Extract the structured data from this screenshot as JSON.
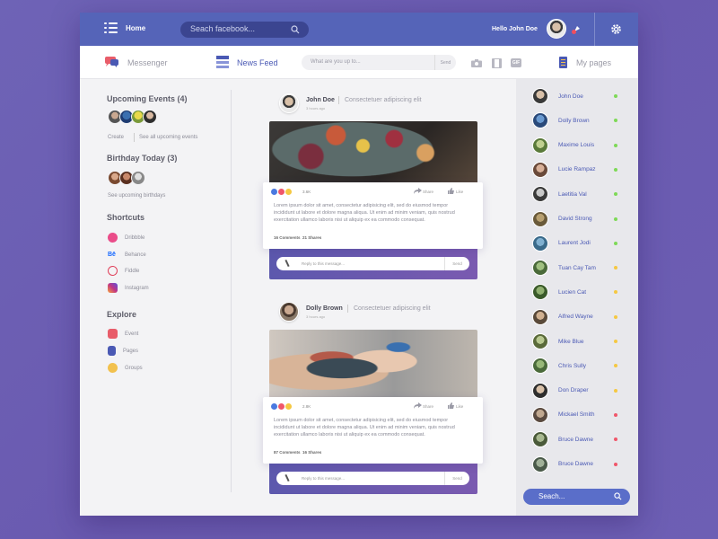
{
  "topbar": {
    "home_label": "Home",
    "search_placeholder": "Seach facebook...",
    "greeting": "Hello John Doe"
  },
  "secondbar": {
    "messenger_label": "Messenger",
    "newsfeed_label": "News Feed",
    "status_placeholder": "What are you up to...",
    "status_send": "Send",
    "gif_label": "GIF",
    "mypages_label": "My pages"
  },
  "left": {
    "upcoming_title": "Upcoming Events (4)",
    "create_label": "Create",
    "see_all_events": "See  all upcoming events",
    "birthday_title": "Birthday Today (3)",
    "see_birthdays": "See upcoming birthdays",
    "shortcuts_title": "Shortcuts",
    "shortcuts": [
      {
        "label": "Dribbble",
        "color": "#ea4c89"
      },
      {
        "label": "Behance",
        "color": "#1769ff"
      },
      {
        "label": "Fiddle",
        "color": "#e0405a"
      },
      {
        "label": "Instagram",
        "color": "#c13584"
      }
    ],
    "explore_title": "Explore",
    "explore": [
      {
        "label": "Event",
        "color": "#e85d6a"
      },
      {
        "label": "Pages",
        "color": "#4a59b4"
      },
      {
        "label": "Groups",
        "color": "#f2c14e"
      }
    ]
  },
  "posts": [
    {
      "author": "John Doe",
      "subtitle": "Consectetuer adipiscing elit",
      "time": "3 hours ago",
      "react_count": "3.6K",
      "share_label": "Share",
      "like_label": "Like",
      "text": "Lorem ipsum dolor sit amet, consectetur adipisicing elit, sed do eiusmod tempor incididunt ut labore et dolore magna aliqua. Ut enim ad minim veniam, quis nostrud exercitation ullamco laboris nisi ut aliquip ex ea commodo consequat.",
      "comments": "16 Comments",
      "shares": "21 Shares",
      "reply_placeholder": "Reply to this message...",
      "reply_send": "Send"
    },
    {
      "author": "Dolly Brown",
      "subtitle": "Consectetuer adipiscing elit",
      "time": "3 hours ago",
      "react_count": "2.8K",
      "share_label": "Share",
      "like_label": "Like",
      "text": "Lorem ipsum dolor sit amet, consectetur adipisicing elit, sed do eiusmod tempor incididunt ut labore et dolore magna aliqua. Ut enim ad minim veniam, quis nostrud exercitation ullamco laboris nisi ut aliquip ex ea commodo consequat.",
      "comments": "87 Comments",
      "shares": "16 Shares",
      "reply_placeholder": "Reply to this message...",
      "reply_send": "Send"
    }
  ],
  "friends": [
    {
      "name": "John Doe",
      "status": "online"
    },
    {
      "name": "Dolly Brown",
      "status": "online"
    },
    {
      "name": "Maxime Louis",
      "status": "online"
    },
    {
      "name": "Lucie Rampaz",
      "status": "online"
    },
    {
      "name": "Laetitia Val",
      "status": "online"
    },
    {
      "name": "David Strong",
      "status": "online"
    },
    {
      "name": "Laurent Jodi",
      "status": "online"
    },
    {
      "name": "Tuan Cay Tam",
      "status": "away"
    },
    {
      "name": "Lucien Cat",
      "status": "away"
    },
    {
      "name": "Alfred Wayne",
      "status": "away"
    },
    {
      "name": "Mike Blue",
      "status": "away"
    },
    {
      "name": "Chris Sully",
      "status": "away"
    },
    {
      "name": "Don Draper",
      "status": "away"
    },
    {
      "name": "Mickael Smith",
      "status": "offline"
    },
    {
      "name": "Bruce Dawne",
      "status": "offline"
    },
    {
      "name": "Bruce Dawne",
      "status": "offline"
    }
  ],
  "right_search_placeholder": "Seach...",
  "colors": {
    "topbar": "#5564b8",
    "accent": "#4a59b4",
    "online": "#7ed957",
    "away": "#f5c842",
    "offline": "#f0566a"
  }
}
